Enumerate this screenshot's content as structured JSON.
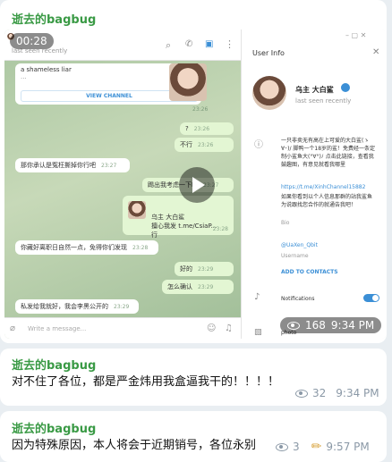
{
  "post1": {
    "sender": "逝去的bagbug",
    "video": {
      "duration": "00:28",
      "views": "168",
      "time": "9:34 PM",
      "tg_header_sub": "last seen recently",
      "tg_channel_text": "a shameless liar",
      "tg_view_channel": "VIEW CHANNEL",
      "bubbles": [
        {
          "text": "?",
          "time": "23:26"
        },
        {
          "text": "不行",
          "time": "23:26"
        },
        {
          "text": "那你承认是冤枉撕掉你行吧",
          "time": "23:27"
        },
        {
          "text": "踢出我考虑一下吧",
          "time": "23:27"
        },
        {
          "text": "乌主 大白鲨\n擅心我发 t.me/CsiaP...\n行",
          "time": "23:28"
        },
        {
          "text": "你藏好离职日自然一点，免得你们发现",
          "time": "23:28"
        },
        {
          "text": "好的",
          "time": "23:29"
        },
        {
          "text": "怎么确认",
          "time": "23:29"
        },
        {
          "text": "私发给我就好，我会李黑公开的",
          "time": "23:29"
        }
      ],
      "write_placeholder": "Write a message...",
      "info": {
        "title": "User Info",
        "name": "乌主 大白鲨",
        "status": "last seen recently",
        "bio": "一只非卖无有高在上可爱的大白鲨(ゝ∀･)/ 脚鸭一个18岁的鲨！免费经一条定制小鲨鱼大(°∀°)ﾉ 点击此链接，查看我鼓趣图，有意见就看我哪里",
        "bio_link": "https://t.me/XinhChannel15882",
        "bio_extra": "如果你看到以个人信息那群的站我鲨鱼为说跟找您合作的就通告我吧！",
        "bio_label": "Bio",
        "username": "@UaXen_Qbit",
        "username_label": "Username",
        "add_contacts": "ADD TO CONTACTS",
        "notifications": "Notifications",
        "photo_label": "photo"
      }
    }
  },
  "post2": {
    "sender": "逝去的bagbug",
    "text": "对不住了各位，都是严金炜用我盒逼我干的！！！！",
    "views": "32",
    "time": "9:34 PM"
  },
  "post3": {
    "sender": "逝去的bagbug",
    "text": "因为特殊原因，本人将会于近期销号，各位永别",
    "views": "3",
    "time": "9:57 PM"
  }
}
